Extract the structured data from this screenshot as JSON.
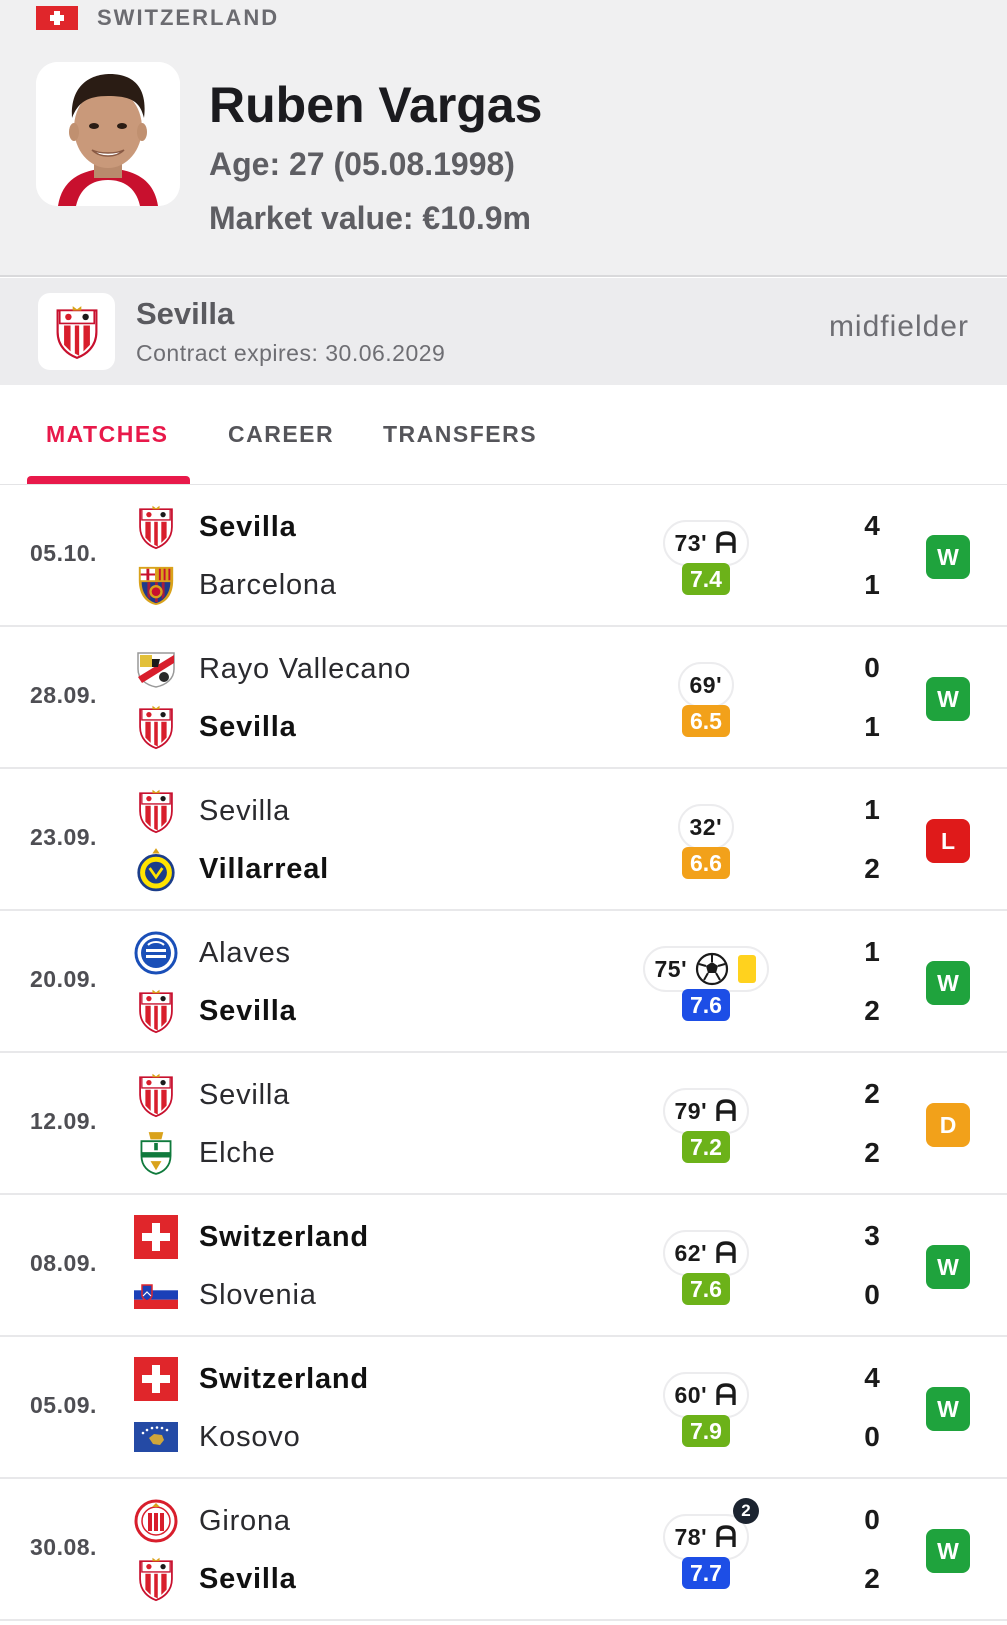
{
  "player": {
    "nation": "SWITZERLAND",
    "name": "Ruben Vargas",
    "age_line": "Age: 27 (05.08.1998)",
    "value_line": "Market value: €10.9m"
  },
  "club": {
    "name": "Sevilla",
    "contract": "Contract expires: 30.06.2029",
    "position": "midfielder"
  },
  "tabs": [
    {
      "label": "MATCHES",
      "active": true
    },
    {
      "label": "CAREER",
      "active": false
    },
    {
      "label": "TRANSFERS",
      "active": false
    }
  ],
  "colors": {
    "accent": "#e8194a",
    "rating_green": "#6cb219",
    "rating_orange": "#f2a11a",
    "rating_blue": "#1d4ee6",
    "result_win": "#1fa33d",
    "result_loss": "#df1a1a",
    "result_draw": "#f2a11a",
    "card_yellow": "#ffd21e"
  },
  "matches": [
    {
      "date": "05.10.",
      "home": {
        "name": "Sevilla",
        "bold": true,
        "logo": "sevilla-crest"
      },
      "away": {
        "name": "Barcelona",
        "bold": false,
        "logo": "barcelona-crest"
      },
      "minutes": "73'",
      "events": [
        "assist"
      ],
      "rating": "7.4",
      "rating_color": "green",
      "score_home": "4",
      "score_away": "1",
      "result": "W"
    },
    {
      "date": "28.09.",
      "home": {
        "name": "Rayo Vallecano",
        "bold": false,
        "logo": "rayo-vallecano-crest"
      },
      "away": {
        "name": "Sevilla",
        "bold": true,
        "logo": "sevilla-crest"
      },
      "minutes": "69'",
      "events": [],
      "rating": "6.5",
      "rating_color": "orange",
      "score_home": "0",
      "score_away": "1",
      "result": "W"
    },
    {
      "date": "23.09.",
      "home": {
        "name": "Sevilla",
        "bold": false,
        "logo": "sevilla-crest"
      },
      "away": {
        "name": "Villarreal",
        "bold": true,
        "logo": "villarreal-crest"
      },
      "minutes": "32'",
      "events": [],
      "rating": "6.6",
      "rating_color": "orange",
      "score_home": "1",
      "score_away": "2",
      "result": "L"
    },
    {
      "date": "20.09.",
      "home": {
        "name": "Alaves",
        "bold": false,
        "logo": "alaves-crest"
      },
      "away": {
        "name": "Sevilla",
        "bold": true,
        "logo": "sevilla-crest"
      },
      "minutes": "75'",
      "events": [
        "goal",
        "yellow-card"
      ],
      "rating": "7.6",
      "rating_color": "blue",
      "score_home": "1",
      "score_away": "2",
      "result": "W"
    },
    {
      "date": "12.09.",
      "home": {
        "name": "Sevilla",
        "bold": false,
        "logo": "sevilla-crest"
      },
      "away": {
        "name": "Elche",
        "bold": false,
        "logo": "elche-crest"
      },
      "minutes": "79'",
      "events": [
        "assist"
      ],
      "rating": "7.2",
      "rating_color": "green",
      "score_home": "2",
      "score_away": "2",
      "result": "D"
    },
    {
      "date": "08.09.",
      "home": {
        "name": "Switzerland",
        "bold": true,
        "logo": "switzerland-flag"
      },
      "away": {
        "name": "Slovenia",
        "bold": false,
        "logo": "slovenia-flag"
      },
      "minutes": "62'",
      "events": [
        "assist"
      ],
      "rating": "7.6",
      "rating_color": "green",
      "score_home": "3",
      "score_away": "0",
      "result": "W"
    },
    {
      "date": "05.09.",
      "home": {
        "name": "Switzerland",
        "bold": true,
        "logo": "switzerland-flag"
      },
      "away": {
        "name": "Kosovo",
        "bold": false,
        "logo": "kosovo-flag"
      },
      "minutes": "60'",
      "events": [
        "assist"
      ],
      "rating": "7.9",
      "rating_color": "green",
      "score_home": "4",
      "score_away": "0",
      "result": "W"
    },
    {
      "date": "30.08.",
      "home": {
        "name": "Girona",
        "bold": false,
        "logo": "girona-crest"
      },
      "away": {
        "name": "Sevilla",
        "bold": true,
        "logo": "sevilla-crest"
      },
      "minutes": "78'",
      "events": [
        "assist"
      ],
      "assist_count": "2",
      "rating": "7.7",
      "rating_color": "blue",
      "score_home": "0",
      "score_away": "2",
      "result": "W"
    }
  ]
}
